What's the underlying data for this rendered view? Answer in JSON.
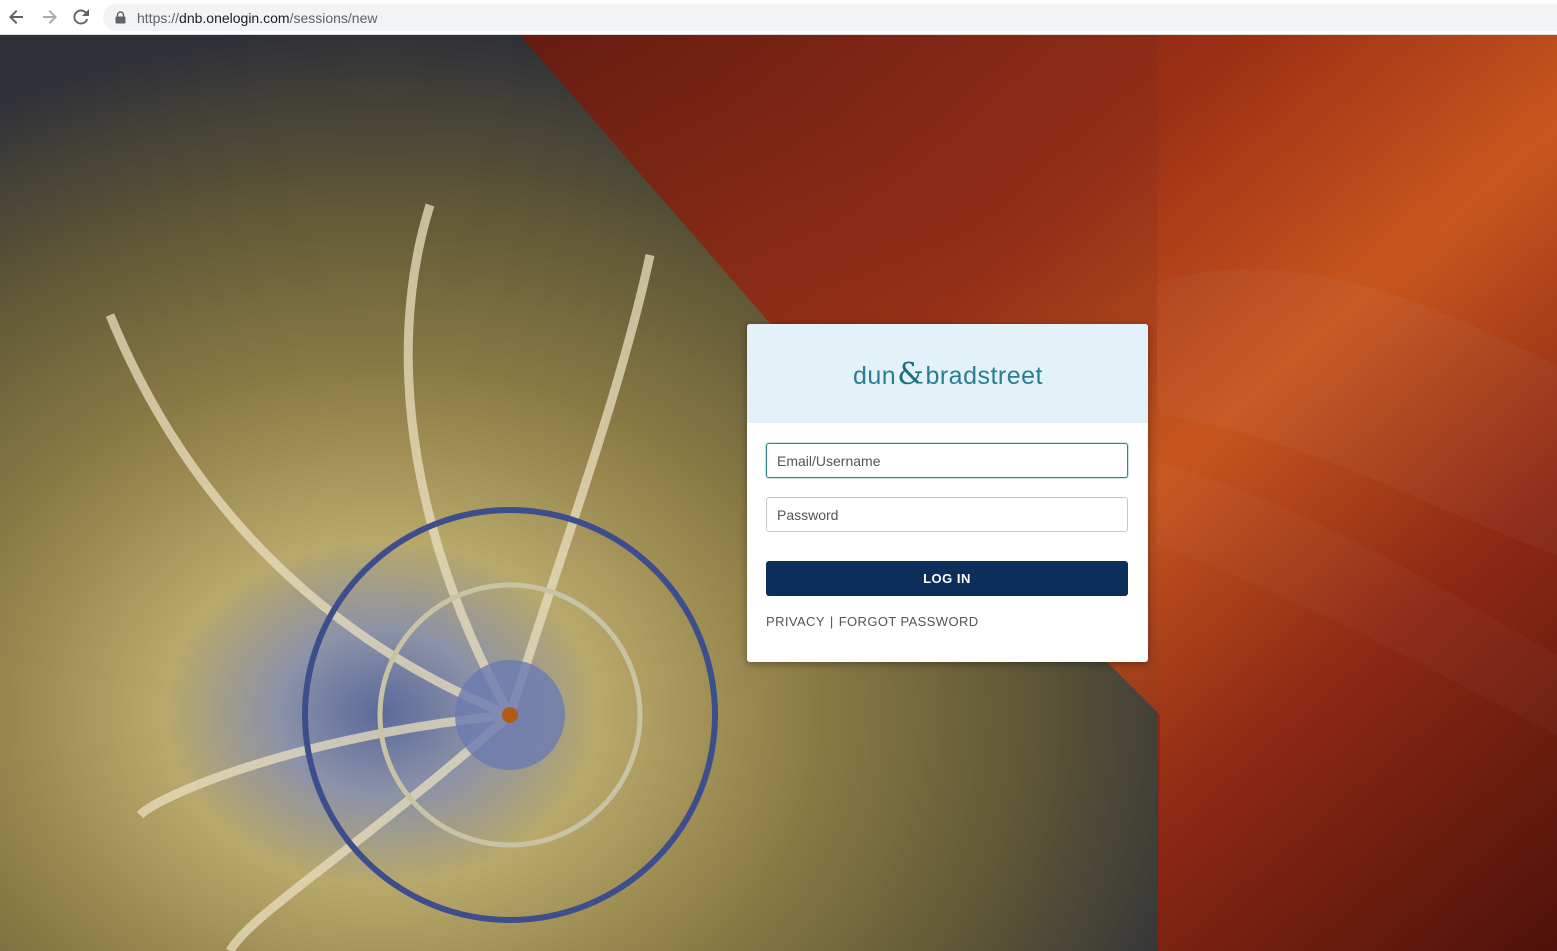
{
  "browser": {
    "url_scheme": "https://",
    "url_host": "dnb.onelogin.com",
    "url_path": "/sessions/new"
  },
  "login": {
    "logo_left": "dun",
    "logo_amp": "&",
    "logo_right": "bradstreet",
    "email_placeholder": "Email/Username",
    "password_placeholder": "Password",
    "login_label": "LOG IN",
    "privacy_label": "PRIVACY",
    "separator": "|",
    "forgot_label": "FORGOT PASSWORD"
  },
  "colors": {
    "brand_teal": "#2a7e90",
    "button_navy": "#0b2e5a",
    "header_bg": "#e3f2f8"
  }
}
